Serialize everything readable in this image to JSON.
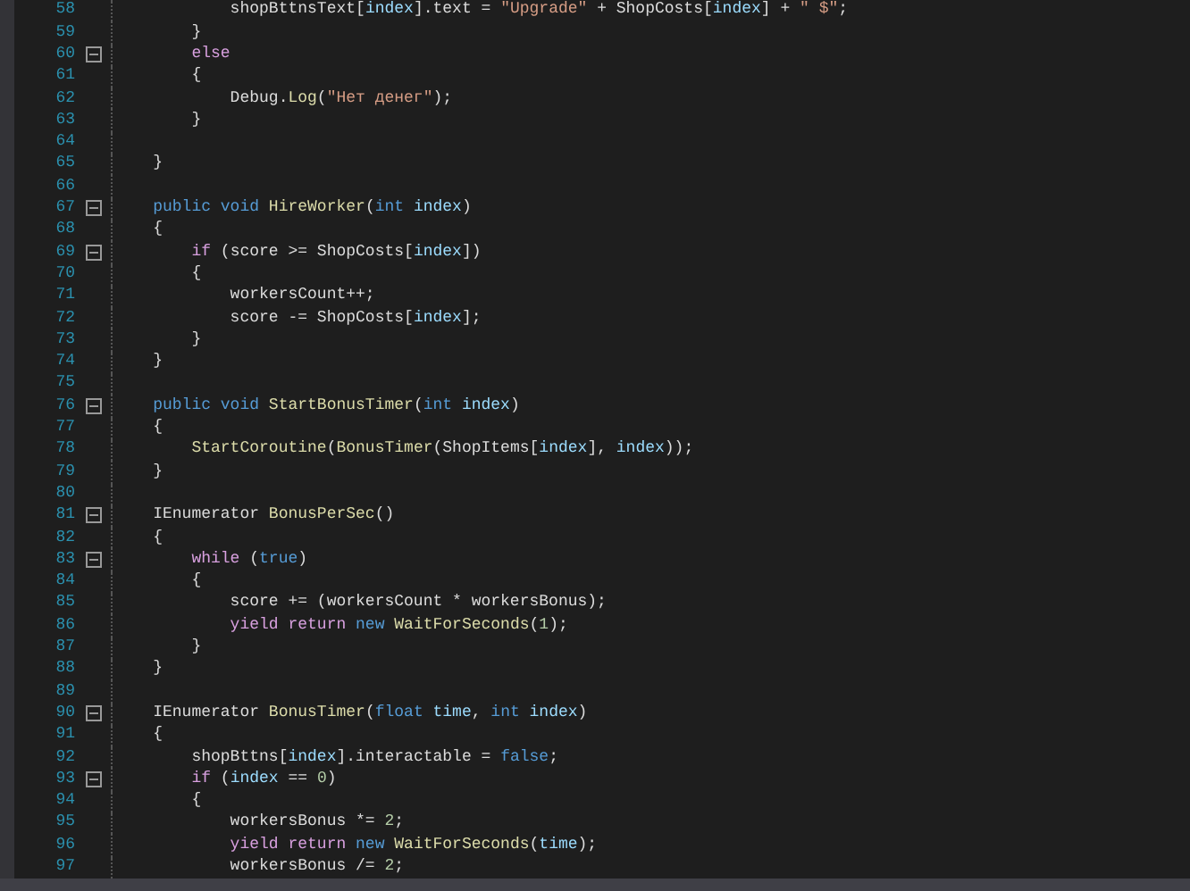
{
  "editor": {
    "lines": [
      {
        "number": "58",
        "tokens": [
          {
            "text": "            shopBttnsText[",
            "kind": "plain"
          },
          {
            "text": "index",
            "kind": "param"
          },
          {
            "text": "].text = ",
            "kind": "plain"
          },
          {
            "text": "\"Upgrade\"",
            "kind": "str"
          },
          {
            "text": " + ShopCosts[",
            "kind": "plain"
          },
          {
            "text": "index",
            "kind": "param"
          },
          {
            "text": "] + ",
            "kind": "plain"
          },
          {
            "text": "\" $\"",
            "kind": "str"
          },
          {
            "text": ";",
            "kind": "plain"
          }
        ]
      },
      {
        "number": "59",
        "tokens": [
          {
            "text": "        }",
            "kind": "plain"
          }
        ]
      },
      {
        "number": "60",
        "fold": true,
        "tokens": [
          {
            "text": "        else",
            "kind": "ctrl"
          }
        ]
      },
      {
        "number": "61",
        "tokens": [
          {
            "text": "        {",
            "kind": "plain"
          }
        ]
      },
      {
        "number": "62",
        "tokens": [
          {
            "text": "            Debug.",
            "kind": "plain"
          },
          {
            "text": "Log",
            "kind": "fn"
          },
          {
            "text": "(",
            "kind": "plain"
          },
          {
            "text": "\"Нет денег\"",
            "kind": "str"
          },
          {
            "text": ");",
            "kind": "plain"
          }
        ]
      },
      {
        "number": "63",
        "tokens": [
          {
            "text": "        }",
            "kind": "plain"
          }
        ]
      },
      {
        "number": "64"
      },
      {
        "number": "65",
        "tokens": [
          {
            "text": "    }",
            "kind": "plain"
          }
        ]
      },
      {
        "number": "66"
      },
      {
        "number": "67",
        "fold": true,
        "tokens": [
          {
            "text": "    public void ",
            "kind": "kw"
          },
          {
            "text": "HireWorker",
            "kind": "fn"
          },
          {
            "text": "(",
            "kind": "plain"
          },
          {
            "text": "int ",
            "kind": "kw"
          },
          {
            "text": "index",
            "kind": "param"
          },
          {
            "text": ")",
            "kind": "plain"
          }
        ]
      },
      {
        "number": "68",
        "tokens": [
          {
            "text": "    {",
            "kind": "plain"
          }
        ]
      },
      {
        "number": "69",
        "fold": true,
        "tokens": [
          {
            "text": "        if",
            "kind": "ctrl"
          },
          {
            "text": " (score >= ShopCosts[",
            "kind": "plain"
          },
          {
            "text": "index",
            "kind": "param"
          },
          {
            "text": "])",
            "kind": "plain"
          }
        ]
      },
      {
        "number": "70",
        "tokens": [
          {
            "text": "        {",
            "kind": "plain"
          }
        ]
      },
      {
        "number": "71",
        "tokens": [
          {
            "text": "            workersCount++;",
            "kind": "plain"
          }
        ]
      },
      {
        "number": "72",
        "tokens": [
          {
            "text": "            score -= ShopCosts[",
            "kind": "plain"
          },
          {
            "text": "index",
            "kind": "param"
          },
          {
            "text": "];",
            "kind": "plain"
          }
        ]
      },
      {
        "number": "73",
        "tokens": [
          {
            "text": "        }",
            "kind": "plain"
          }
        ]
      },
      {
        "number": "74",
        "tokens": [
          {
            "text": "    }",
            "kind": "plain"
          }
        ]
      },
      {
        "number": "75"
      },
      {
        "number": "76",
        "fold": true,
        "tokens": [
          {
            "text": "    public void ",
            "kind": "kw"
          },
          {
            "text": "StartBonusTimer",
            "kind": "fn"
          },
          {
            "text": "(",
            "kind": "plain"
          },
          {
            "text": "int ",
            "kind": "kw"
          },
          {
            "text": "index",
            "kind": "param"
          },
          {
            "text": ")",
            "kind": "plain"
          }
        ]
      },
      {
        "number": "77",
        "tokens": [
          {
            "text": "    {",
            "kind": "plain"
          }
        ]
      },
      {
        "number": "78",
        "tokens": [
          {
            "text": "        StartCoroutine",
            "kind": "fn"
          },
          {
            "text": "(",
            "kind": "plain"
          },
          {
            "text": "BonusTimer",
            "kind": "fn"
          },
          {
            "text": "(ShopItems[",
            "kind": "plain"
          },
          {
            "text": "index",
            "kind": "param"
          },
          {
            "text": "], ",
            "kind": "plain"
          },
          {
            "text": "index",
            "kind": "param"
          },
          {
            "text": "));",
            "kind": "plain"
          }
        ]
      },
      {
        "number": "79",
        "tokens": [
          {
            "text": "    }",
            "kind": "plain"
          }
        ]
      },
      {
        "number": "80"
      },
      {
        "number": "81",
        "fold": true,
        "tokens": [
          {
            "text": "    IEnumerator ",
            "kind": "plain"
          },
          {
            "text": "BonusPerSec",
            "kind": "fn"
          },
          {
            "text": "()",
            "kind": "plain"
          }
        ]
      },
      {
        "number": "82",
        "tokens": [
          {
            "text": "    {",
            "kind": "plain"
          }
        ]
      },
      {
        "number": "83",
        "fold": true,
        "tokens": [
          {
            "text": "        while",
            "kind": "ctrl"
          },
          {
            "text": " (",
            "kind": "plain"
          },
          {
            "text": "true",
            "kind": "kw"
          },
          {
            "text": ")",
            "kind": "plain"
          }
        ]
      },
      {
        "number": "84",
        "tokens": [
          {
            "text": "        {",
            "kind": "plain"
          }
        ]
      },
      {
        "number": "85",
        "tokens": [
          {
            "text": "            score += (workersCount * workersBonus);",
            "kind": "plain"
          }
        ]
      },
      {
        "number": "86",
        "tokens": [
          {
            "text": "            yield return ",
            "kind": "ctrl"
          },
          {
            "text": "new ",
            "kind": "kw"
          },
          {
            "text": "WaitForSeconds",
            "kind": "fn"
          },
          {
            "text": "(",
            "kind": "plain"
          },
          {
            "text": "1",
            "kind": "num"
          },
          {
            "text": ");",
            "kind": "plain"
          }
        ]
      },
      {
        "number": "87",
        "tokens": [
          {
            "text": "        }",
            "kind": "plain"
          }
        ]
      },
      {
        "number": "88",
        "tokens": [
          {
            "text": "    }",
            "kind": "plain"
          }
        ]
      },
      {
        "number": "89"
      },
      {
        "number": "90",
        "fold": true,
        "tokens": [
          {
            "text": "    IEnumerator ",
            "kind": "plain"
          },
          {
            "text": "BonusTimer",
            "kind": "fn"
          },
          {
            "text": "(",
            "kind": "plain"
          },
          {
            "text": "float ",
            "kind": "kw"
          },
          {
            "text": "time",
            "kind": "param"
          },
          {
            "text": ", ",
            "kind": "plain"
          },
          {
            "text": "int ",
            "kind": "kw"
          },
          {
            "text": "index",
            "kind": "param"
          },
          {
            "text": ")",
            "kind": "plain"
          }
        ]
      },
      {
        "number": "91",
        "tokens": [
          {
            "text": "    {",
            "kind": "plain"
          }
        ]
      },
      {
        "number": "92",
        "tokens": [
          {
            "text": "        shopBttns[",
            "kind": "plain"
          },
          {
            "text": "index",
            "kind": "param"
          },
          {
            "text": "].interactable = ",
            "kind": "plain"
          },
          {
            "text": "false",
            "kind": "kw"
          },
          {
            "text": ";",
            "kind": "plain"
          }
        ]
      },
      {
        "number": "93",
        "fold": true,
        "tokens": [
          {
            "text": "        if",
            "kind": "ctrl"
          },
          {
            "text": " (",
            "kind": "plain"
          },
          {
            "text": "index",
            "kind": "param"
          },
          {
            "text": " == ",
            "kind": "plain"
          },
          {
            "text": "0",
            "kind": "num"
          },
          {
            "text": ")",
            "kind": "plain"
          }
        ]
      },
      {
        "number": "94",
        "tokens": [
          {
            "text": "        {",
            "kind": "plain"
          }
        ]
      },
      {
        "number": "95",
        "tokens": [
          {
            "text": "            workersBonus *= ",
            "kind": "plain"
          },
          {
            "text": "2",
            "kind": "num"
          },
          {
            "text": ";",
            "kind": "plain"
          }
        ]
      },
      {
        "number": "96",
        "tokens": [
          {
            "text": "            yield return ",
            "kind": "ctrl"
          },
          {
            "text": "new ",
            "kind": "kw"
          },
          {
            "text": "WaitForSeconds",
            "kind": "fn"
          },
          {
            "text": "(",
            "kind": "plain"
          },
          {
            "text": "time",
            "kind": "param"
          },
          {
            "text": ");",
            "kind": "plain"
          }
        ]
      },
      {
        "number": "97",
        "tokens": [
          {
            "text": "            workersBonus /= ",
            "kind": "plain"
          },
          {
            "text": "2",
            "kind": "num"
          },
          {
            "text": ";",
            "kind": "plain"
          }
        ]
      }
    ]
  }
}
